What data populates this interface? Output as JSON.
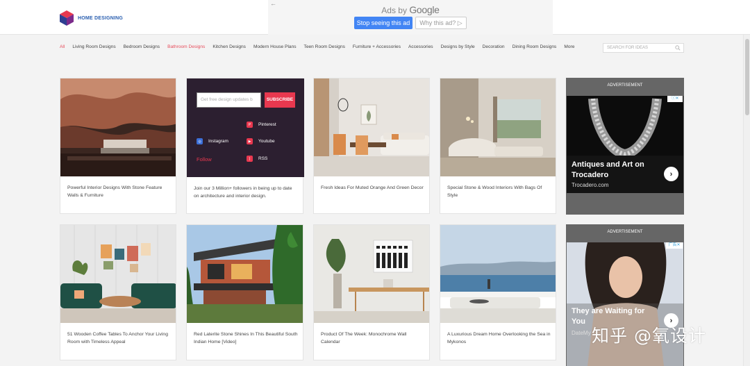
{
  "header": {
    "logo_text": "HOME DESIGNING",
    "ad": {
      "ads_by": "Ads by",
      "google": "Google",
      "stop_label": "Stop seeing this ad",
      "why_label": "Why this ad? ▷",
      "back": "←"
    }
  },
  "nav": {
    "items": [
      "All",
      "Living Room Designs",
      "Bedroom Designs",
      "Bathroom Designs",
      "Kitchen Designs",
      "Modern House Plans",
      "Teen Room Designs",
      "Furniture + Accessories",
      "Accessories",
      "Designs by Style",
      "Decoration",
      "Dining Room Designs",
      "More"
    ],
    "active_index": 0,
    "highlight_index": 3,
    "search_placeholder": "SEARCH FOR IDEAS"
  },
  "subscribe": {
    "email_placeholder": "Get free design updates b",
    "button": "SUBSCRIBE",
    "pinterest": "Pinterest",
    "instagram": "Instagram",
    "youtube": "Youtube",
    "follow": "Follow",
    "rss": "RSS",
    "caption": "Join our 3 Million+ followers in being up to date on architecture and interior design."
  },
  "cards": [
    {
      "caption": "Powerful Interior Designs With Stone Feature Walls & Furniture"
    },
    {
      "caption": "Fresh Ideas For Muted Orange And Green Decor"
    },
    {
      "caption": "Special Stone & Wood Interiors With Bags Of Style"
    },
    {
      "caption": "51 Wooden Coffee Tables To Anchor Your Living Room with Timeless Appeal"
    },
    {
      "caption": "Red Laterite Stone Shines In This Beautiful South Indian Home [Video]"
    },
    {
      "caption": "Product Of The Week: Monochrome Wall Calendar"
    },
    {
      "caption": "A Luxurious Dream Home Overlooking the Sea in Mykonos"
    }
  ],
  "ads": [
    {
      "label": "ADVERTISEMENT",
      "title": "Antiques and Art on Trocadero",
      "source": "Trocadero.com",
      "choice": "ⓘ✕"
    },
    {
      "label": "ADVERTISEMENT",
      "title": "They are Waiting for You",
      "source": "DateMy",
      "choice": "广告✕"
    }
  ],
  "watermark": "知乎 @氧设计",
  "colors": {
    "accent": "#e74c5b",
    "google_blue": "#4285f4",
    "subscribe_bg": "#2c1f30"
  }
}
